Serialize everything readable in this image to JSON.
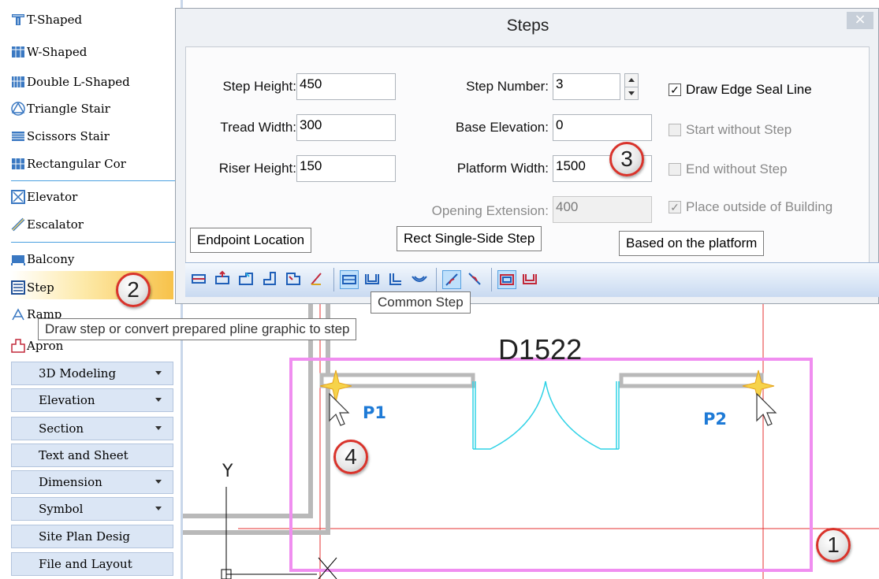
{
  "sidebar": {
    "items": [
      {
        "label": "T-Shaped"
      },
      {
        "label": "W-Shaped"
      },
      {
        "label": "Double L-Shaped"
      },
      {
        "label": "Triangle Stair"
      },
      {
        "label": "Scissors Stair"
      },
      {
        "label": "Rectangular Cor"
      },
      {
        "label": "Elevator"
      },
      {
        "label": "Escalator"
      },
      {
        "label": "Balcony"
      },
      {
        "label": "Step"
      },
      {
        "label": "Ramp"
      },
      {
        "label": "Apron"
      }
    ],
    "menus": [
      {
        "label": "3D Modeling",
        "has_arrow": true
      },
      {
        "label": "Elevation",
        "has_arrow": true
      },
      {
        "label": "Section",
        "has_arrow": true
      },
      {
        "label": "Text and Sheet",
        "has_arrow": false
      },
      {
        "label": "Dimension",
        "has_arrow": true
      },
      {
        "label": "Symbol",
        "has_arrow": true
      },
      {
        "label": "Site Plan Desig",
        "has_arrow": false
      },
      {
        "label": "File and Layout",
        "has_arrow": false
      }
    ]
  },
  "step_tooltip": "Draw step or convert prepared pline graphic to step",
  "dialog": {
    "title": "Steps",
    "close_glyph": "×",
    "fields": {
      "step_height": {
        "label": "Step Height:",
        "value": "450"
      },
      "tread_width": {
        "label": "Tread Width:",
        "value": "300"
      },
      "riser_height": {
        "label": "Riser Height:",
        "value": "150"
      },
      "step_number": {
        "label": "Step Number:",
        "value": "3"
      },
      "base_elevation": {
        "label": "Base Elevation:",
        "value": "0"
      },
      "platform_width": {
        "label": "Platform Width:",
        "value": "1500"
      },
      "opening_extension": {
        "label": "Opening Extension:",
        "value": "400"
      }
    },
    "checkboxes": {
      "draw_edge_seal": {
        "label": "Draw Edge Seal Line",
        "checked": true,
        "enabled": true
      },
      "start_without_step": {
        "label": "Start without Step",
        "checked": false,
        "enabled": false
      },
      "end_without_step": {
        "label": "End without Step",
        "checked": false,
        "enabled": false
      },
      "place_outside": {
        "label": "Place outside of Building",
        "checked": true,
        "enabled": false
      }
    },
    "group_labels": {
      "endpoint": "Endpoint Location",
      "rect_single": "Rect Single-Side Step",
      "based_platform": "Based on the platform"
    },
    "toolbar_tooltip": "Common Step"
  },
  "drawing": {
    "door_label": "D1522",
    "p1": "P1",
    "p2": "P2",
    "y_axis": "Y",
    "x_axis": "X"
  },
  "callouts": {
    "c1": "1",
    "c2": "2",
    "c3": "3",
    "c4": "4"
  },
  "colors": {
    "selection": "#f08ef0",
    "wall": "#b9b9b9",
    "door": "#2fd2e6",
    "grid": "#e63030",
    "point_label": "#1e7ad6",
    "highlight": "#f7c24a"
  }
}
